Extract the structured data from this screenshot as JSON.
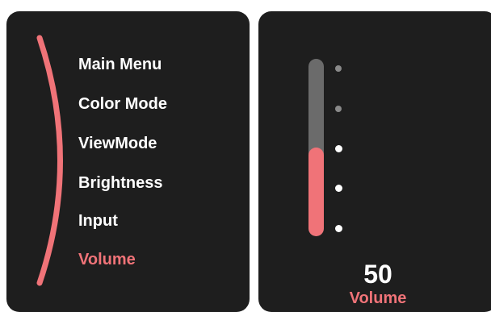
{
  "menu": {
    "items": [
      {
        "label": "Main Menu",
        "active": false
      },
      {
        "label": "Color Mode",
        "active": false
      },
      {
        "label": "ViewMode",
        "active": false
      },
      {
        "label": "Brightness",
        "active": false
      },
      {
        "label": "Input",
        "active": false
      },
      {
        "label": "Volume",
        "active": true
      }
    ]
  },
  "volume": {
    "value": "50",
    "label": "Volume",
    "level": 0.5,
    "scale_dots": 5
  },
  "colors": {
    "accent": "#f07378",
    "panel_bg": "#1e1e1e",
    "track": "#6b6b6b",
    "text": "#ffffff",
    "dot_inactive": "#8a8a8a",
    "dot_active": "#ffffff"
  }
}
